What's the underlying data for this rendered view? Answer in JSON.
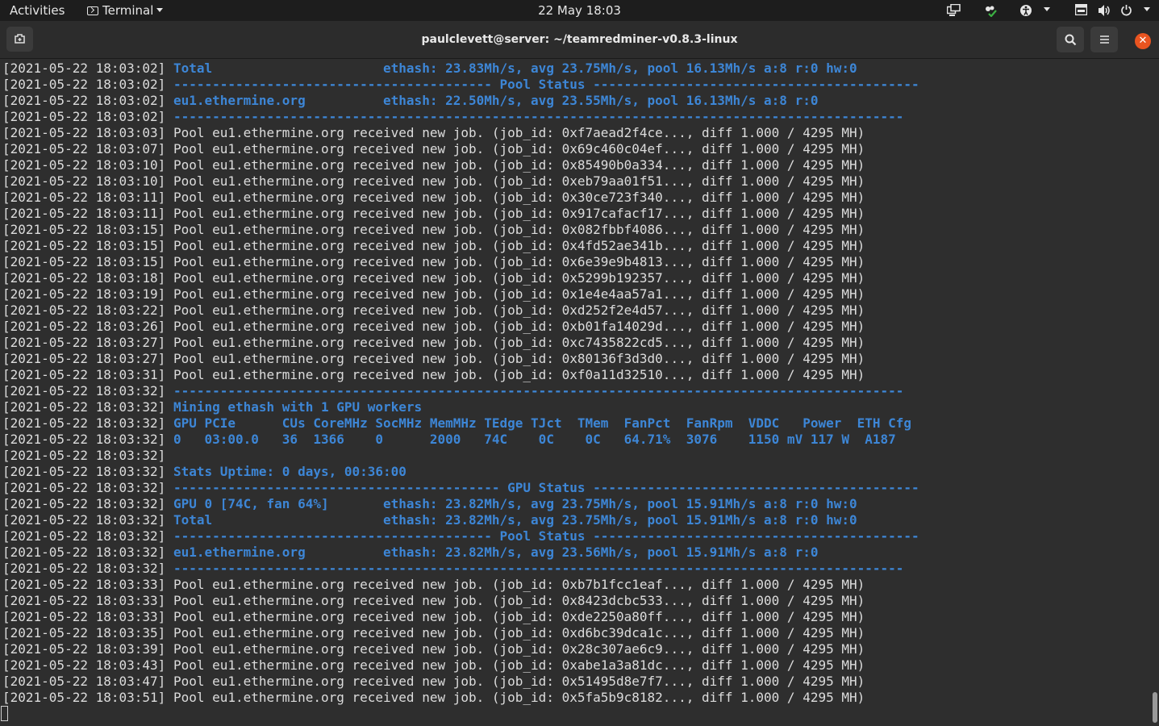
{
  "topbar": {
    "activities": "Activities",
    "app_menu": "Terminal",
    "clock": "22 May  18:03"
  },
  "window": {
    "title": "paulclevett@server: ~/teamredminer-v0.8.3-linux",
    "icons": [
      "new-tab-icon",
      "search-icon",
      "hamburger-menu-icon",
      "close-icon"
    ],
    "close_symbol": "✕"
  },
  "colors": {
    "highlight": "#3d86d6",
    "text": "#dcdcdc",
    "background": "#2e2e2e",
    "accent_close": "#e95420"
  },
  "terminal": {
    "lines": [
      {
        "ts": "[2021-05-22 18:03:02]",
        "msg": "Total                      ethash: 23.83Mh/s, avg 23.75Mh/s, pool 16.13Mh/s a:8 r:0 hw:0",
        "blue": true
      },
      {
        "ts": "[2021-05-22 18:03:02]",
        "msg": "----------------------------------------- Pool Status ------------------------------------------",
        "blue": true
      },
      {
        "ts": "[2021-05-22 18:03:02]",
        "msg": "eu1.ethermine.org          ethash: 22.50Mh/s, avg 23.55Mh/s, pool 16.13Mh/s a:8 r:0",
        "blue": true
      },
      {
        "ts": "[2021-05-22 18:03:02]",
        "msg": "----------------------------------------------------------------------------------------------",
        "blue": true
      },
      {
        "ts": "[2021-05-22 18:03:03]",
        "msg": "Pool eu1.ethermine.org received new job. (job_id: 0xf7aead2f4ce..., diff 1.000 / 4295 MH)",
        "blue": false
      },
      {
        "ts": "[2021-05-22 18:03:07]",
        "msg": "Pool eu1.ethermine.org received new job. (job_id: 0x69c460c04ef..., diff 1.000 / 4295 MH)",
        "blue": false
      },
      {
        "ts": "[2021-05-22 18:03:10]",
        "msg": "Pool eu1.ethermine.org received new job. (job_id: 0x85490b0a334..., diff 1.000 / 4295 MH)",
        "blue": false
      },
      {
        "ts": "[2021-05-22 18:03:10]",
        "msg": "Pool eu1.ethermine.org received new job. (job_id: 0xeb79aa01f51..., diff 1.000 / 4295 MH)",
        "blue": false
      },
      {
        "ts": "[2021-05-22 18:03:11]",
        "msg": "Pool eu1.ethermine.org received new job. (job_id: 0x30ce723f340..., diff 1.000 / 4295 MH)",
        "blue": false
      },
      {
        "ts": "[2021-05-22 18:03:11]",
        "msg": "Pool eu1.ethermine.org received new job. (job_id: 0x917cafacf17..., diff 1.000 / 4295 MH)",
        "blue": false
      },
      {
        "ts": "[2021-05-22 18:03:15]",
        "msg": "Pool eu1.ethermine.org received new job. (job_id: 0x082fbbf4086..., diff 1.000 / 4295 MH)",
        "blue": false
      },
      {
        "ts": "[2021-05-22 18:03:15]",
        "msg": "Pool eu1.ethermine.org received new job. (job_id: 0x4fd52ae341b..., diff 1.000 / 4295 MH)",
        "blue": false
      },
      {
        "ts": "[2021-05-22 18:03:15]",
        "msg": "Pool eu1.ethermine.org received new job. (job_id: 0x6e39e9b4813..., diff 1.000 / 4295 MH)",
        "blue": false
      },
      {
        "ts": "[2021-05-22 18:03:18]",
        "msg": "Pool eu1.ethermine.org received new job. (job_id: 0x5299b192357..., diff 1.000 / 4295 MH)",
        "blue": false
      },
      {
        "ts": "[2021-05-22 18:03:19]",
        "msg": "Pool eu1.ethermine.org received new job. (job_id: 0x1e4e4aa57a1..., diff 1.000 / 4295 MH)",
        "blue": false
      },
      {
        "ts": "[2021-05-22 18:03:22]",
        "msg": "Pool eu1.ethermine.org received new job. (job_id: 0xd252f2e4d57..., diff 1.000 / 4295 MH)",
        "blue": false
      },
      {
        "ts": "[2021-05-22 18:03:26]",
        "msg": "Pool eu1.ethermine.org received new job. (job_id: 0xb01fa14029d..., diff 1.000 / 4295 MH)",
        "blue": false
      },
      {
        "ts": "[2021-05-22 18:03:27]",
        "msg": "Pool eu1.ethermine.org received new job. (job_id: 0xc7435822cd5..., diff 1.000 / 4295 MH)",
        "blue": false
      },
      {
        "ts": "[2021-05-22 18:03:27]",
        "msg": "Pool eu1.ethermine.org received new job. (job_id: 0x80136f3d3d0..., diff 1.000 / 4295 MH)",
        "blue": false
      },
      {
        "ts": "[2021-05-22 18:03:31]",
        "msg": "Pool eu1.ethermine.org received new job. (job_id: 0xf0a11d32510..., diff 1.000 / 4295 MH)",
        "blue": false
      },
      {
        "ts": "[2021-05-22 18:03:32]",
        "msg": "----------------------------------------------------------------------------------------------",
        "blue": true
      },
      {
        "ts": "[2021-05-22 18:03:32]",
        "msg": "Mining ethash with 1 GPU workers",
        "blue": true
      },
      {
        "ts": "[2021-05-22 18:03:32]",
        "msg": "GPU PCIe      CUs CoreMHz SocMHz MemMHz TEdge TJct  TMem  FanPct  FanRpm  VDDC   Power  ETH Cfg",
        "blue": true
      },
      {
        "ts": "[2021-05-22 18:03:32]",
        "msg": "0   03:00.0   36  1366    0      2000   74C    0C    0C   64.71%  3076    1150 mV 117 W  A187",
        "blue": true
      },
      {
        "ts": "[2021-05-22 18:03:32]",
        "msg": "",
        "blue": false
      },
      {
        "ts": "[2021-05-22 18:03:32]",
        "msg": "Stats Uptime: 0 days, 00:36:00",
        "blue": true
      },
      {
        "ts": "[2021-05-22 18:03:32]",
        "msg": "------------------------------------------ GPU Status ------------------------------------------",
        "blue": true
      },
      {
        "ts": "[2021-05-22 18:03:32]",
        "msg": "GPU 0 [74C, fan 64%]       ethash: 23.82Mh/s, avg 23.75Mh/s, pool 15.91Mh/s a:8 r:0 hw:0",
        "blue": true
      },
      {
        "ts": "[2021-05-22 18:03:32]",
        "msg": "Total                      ethash: 23.82Mh/s, avg 23.75Mh/s, pool 15.91Mh/s a:8 r:0 hw:0",
        "blue": true
      },
      {
        "ts": "[2021-05-22 18:03:32]",
        "msg": "----------------------------------------- Pool Status ------------------------------------------",
        "blue": true
      },
      {
        "ts": "[2021-05-22 18:03:32]",
        "msg": "eu1.ethermine.org          ethash: 23.82Mh/s, avg 23.56Mh/s, pool 15.91Mh/s a:8 r:0",
        "blue": true
      },
      {
        "ts": "[2021-05-22 18:03:32]",
        "msg": "----------------------------------------------------------------------------------------------",
        "blue": true
      },
      {
        "ts": "[2021-05-22 18:03:33]",
        "msg": "Pool eu1.ethermine.org received new job. (job_id: 0xb7b1fcc1eaf..., diff 1.000 / 4295 MH)",
        "blue": false
      },
      {
        "ts": "[2021-05-22 18:03:33]",
        "msg": "Pool eu1.ethermine.org received new job. (job_id: 0x8423dcbc533..., diff 1.000 / 4295 MH)",
        "blue": false
      },
      {
        "ts": "[2021-05-22 18:03:33]",
        "msg": "Pool eu1.ethermine.org received new job. (job_id: 0xde2250a80ff..., diff 1.000 / 4295 MH)",
        "blue": false
      },
      {
        "ts": "[2021-05-22 18:03:35]",
        "msg": "Pool eu1.ethermine.org received new job. (job_id: 0xd6bc39dca1c..., diff 1.000 / 4295 MH)",
        "blue": false
      },
      {
        "ts": "[2021-05-22 18:03:39]",
        "msg": "Pool eu1.ethermine.org received new job. (job_id: 0x28c307ae6c9..., diff 1.000 / 4295 MH)",
        "blue": false
      },
      {
        "ts": "[2021-05-22 18:03:43]",
        "msg": "Pool eu1.ethermine.org received new job. (job_id: 0xabe1a3a81dc..., diff 1.000 / 4295 MH)",
        "blue": false
      },
      {
        "ts": "[2021-05-22 18:03:47]",
        "msg": "Pool eu1.ethermine.org received new job. (job_id: 0x51495d8e7f7..., diff 1.000 / 4295 MH)",
        "blue": false
      },
      {
        "ts": "[2021-05-22 18:03:51]",
        "msg": "Pool eu1.ethermine.org received new job. (job_id: 0x5fa5b9c8182..., diff 1.000 / 4295 MH)",
        "blue": false
      }
    ]
  }
}
